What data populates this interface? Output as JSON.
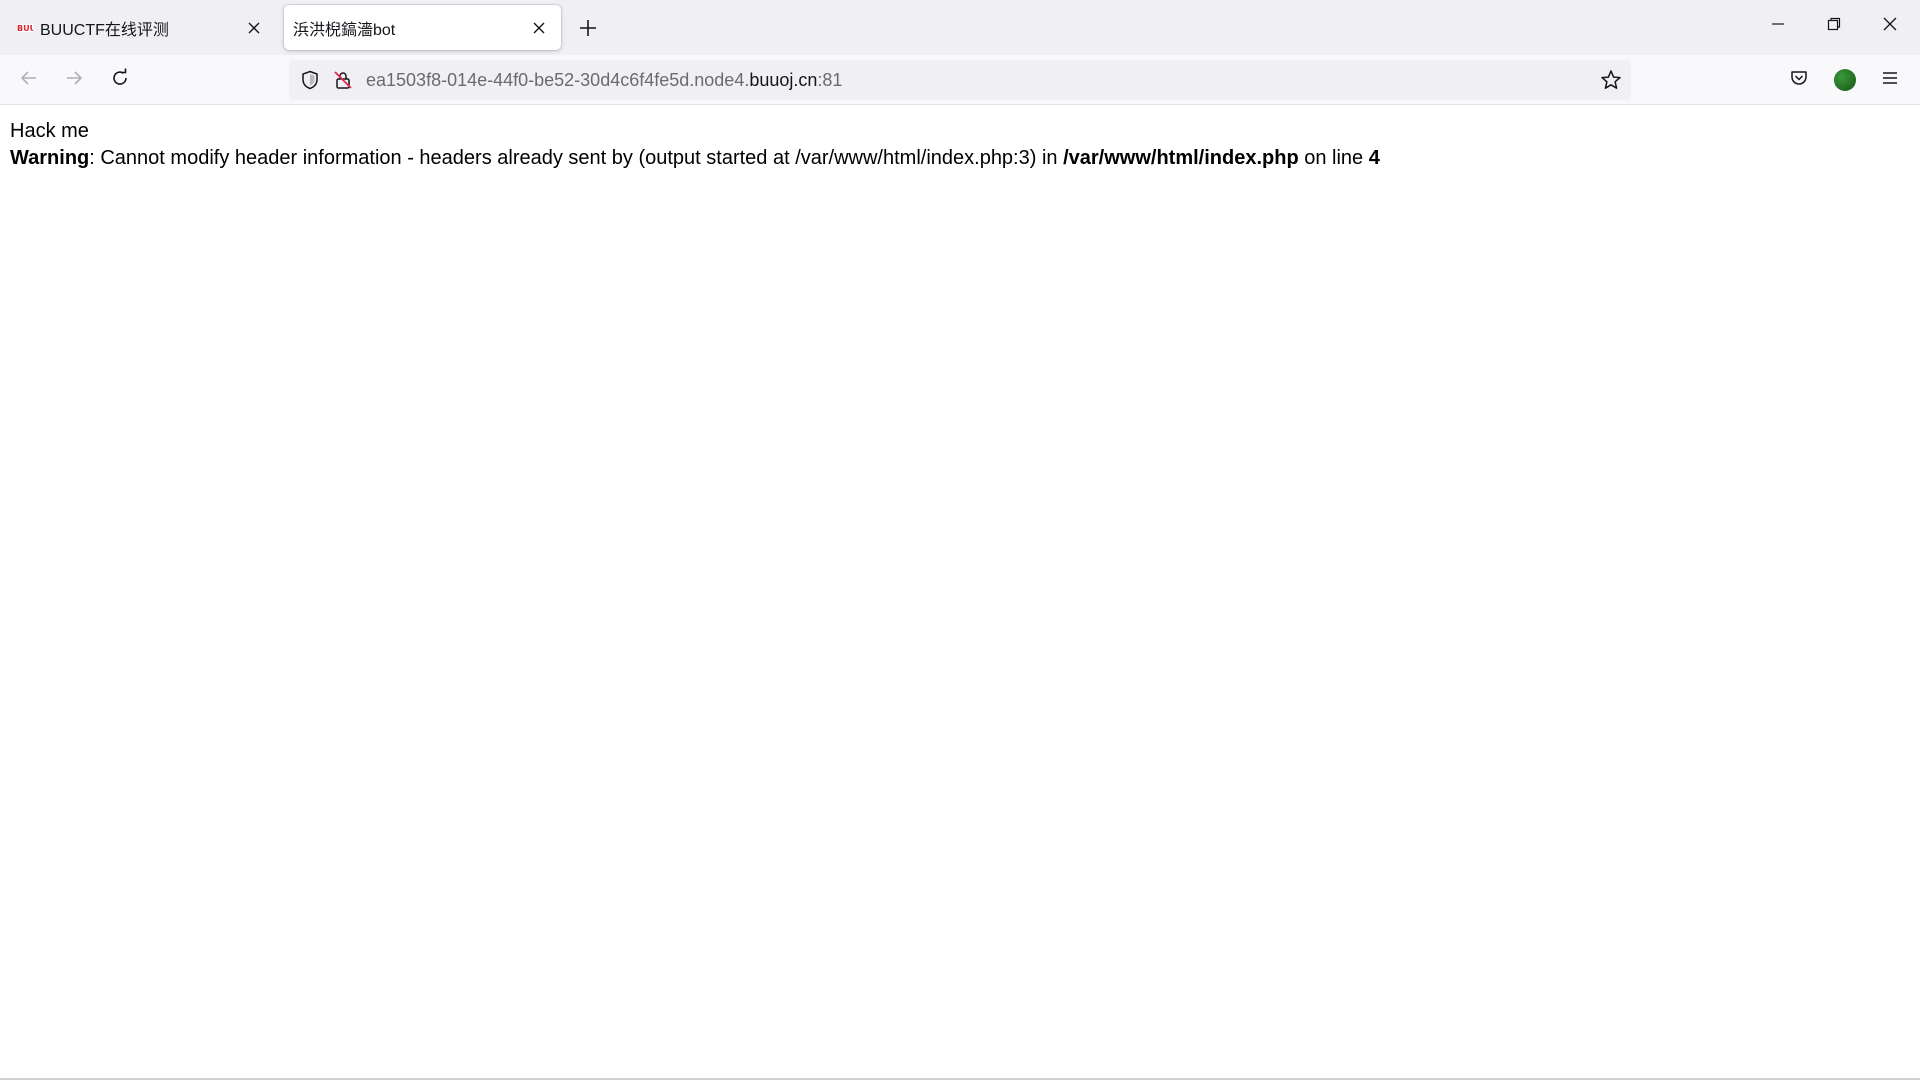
{
  "tabs": [
    {
      "title": "BUUCTF在线评测",
      "active": false,
      "favicon": "buuctf-favicon"
    },
    {
      "title": "浜洪棿鎬濇bot",
      "active": true
    }
  ],
  "window_controls": [
    "minimize",
    "restore",
    "close"
  ],
  "address_bar": {
    "url_prefix": "ea1503f8-014e-44f0-be52-30d4c6f4fe5d.node4.",
    "url_domain": "buuoj.cn",
    "url_suffix": ":81"
  },
  "page": {
    "line1": "Hack me",
    "warning_label": "Warning",
    "warning_message": ": Cannot modify header information - headers already sent by (output started at /var/www/html/index.php:3) in ",
    "warning_file": "/var/www/html/index.php",
    "warning_line_text": " on line ",
    "warning_line_number": "4"
  },
  "colors": {
    "tabstrip_bg": "#f0f0f4",
    "toolbar_bg": "#f9f9fb",
    "text": "#15141a"
  }
}
